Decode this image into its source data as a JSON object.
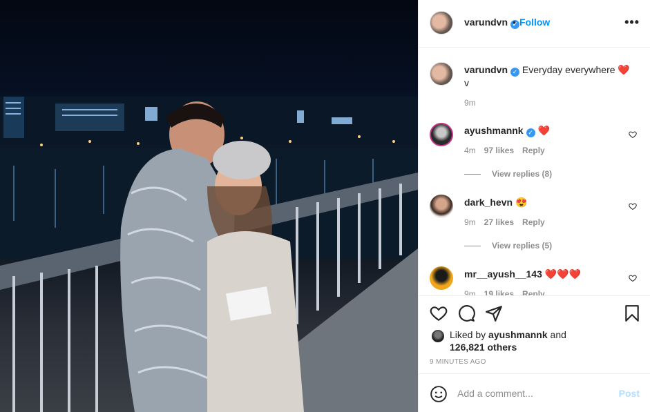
{
  "post": {
    "username": "varundvn",
    "follow_label": "Follow",
    "dot": "•",
    "more_label": "•••",
    "verified_mark": "✓"
  },
  "caption": {
    "username": "varundvn",
    "text": "Everyday everywhere",
    "emoji": "❤️",
    "second_line": "v",
    "time": "9m"
  },
  "comments": [
    {
      "username": "ayushmannk",
      "verified": true,
      "text": "❤️",
      "time": "4m",
      "likes": "97 likes",
      "reply_label": "Reply",
      "view_replies": "View replies (8)"
    },
    {
      "username": "dark_hevn",
      "verified": false,
      "text": "😍",
      "time": "9m",
      "likes": "27 likes",
      "reply_label": "Reply",
      "view_replies": "View replies (5)"
    },
    {
      "username": "mr__ayush__143",
      "verified": false,
      "text": "❤️❤️❤️",
      "time": "9m",
      "likes": "19 likes",
      "reply_label": "Reply"
    }
  ],
  "likes": {
    "prefix": "Liked by",
    "liker": "ayushmannk",
    "connector": "and",
    "others": "126,821 others"
  },
  "time_ago": "9 MINUTES AGO",
  "add_comment": {
    "placeholder": "Add a comment...",
    "post_label": "Post"
  },
  "icons": {
    "like": "heart-icon",
    "comment": "comment-icon",
    "share": "paper-plane-icon",
    "save": "bookmark-icon",
    "emoji": "smiley-icon",
    "more": "ellipsis-icon"
  },
  "colors": {
    "link_blue": "#0095f6",
    "post_disabled": "#b2dffc",
    "verified": "#3897f0",
    "muted": "#8e8e8e",
    "heart_red": "#ed4956"
  }
}
